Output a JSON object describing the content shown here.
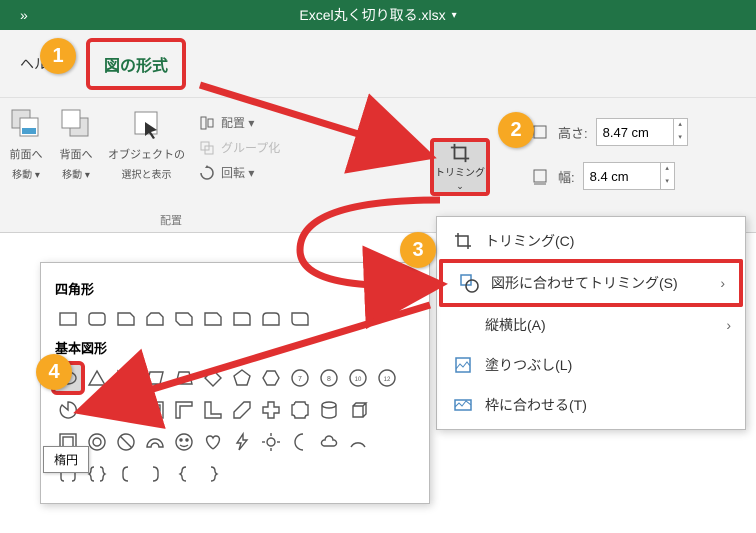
{
  "title": "Excel丸く切り取る.xlsx",
  "tabs": {
    "help": "ヘルプ",
    "picture_format": "図の形式"
  },
  "ribbon": {
    "bring_forward": "前面へ",
    "bring_forward_sub": "移動 ▾",
    "send_backward": "背面へ",
    "send_backward_sub": "移動 ▾",
    "selection_pane": "オブジェクトの",
    "selection_pane_sub": "選択と表示",
    "align": "配置 ▾",
    "group": "グループ化",
    "rotate": "回転 ▾",
    "arrange_group": "配置",
    "trimming": "トリミング",
    "height_label": "高さ:",
    "height_value": "8.47 cm",
    "width_label": "幅:",
    "width_value": "8.4 cm"
  },
  "trim_menu": {
    "crop": "トリミング(C)",
    "crop_to_shape": "図形に合わせてトリミング(S)",
    "aspect_ratio": "縦横比(A)",
    "fill": "塗りつぶし(L)",
    "fit": "枠に合わせる(T)"
  },
  "shape_gallery": {
    "rectangles": "四角形",
    "basic_shapes": "基本図形",
    "tooltip": "楕円"
  },
  "badges": {
    "b1": "1",
    "b2": "2",
    "b3": "3",
    "b4": "4"
  }
}
